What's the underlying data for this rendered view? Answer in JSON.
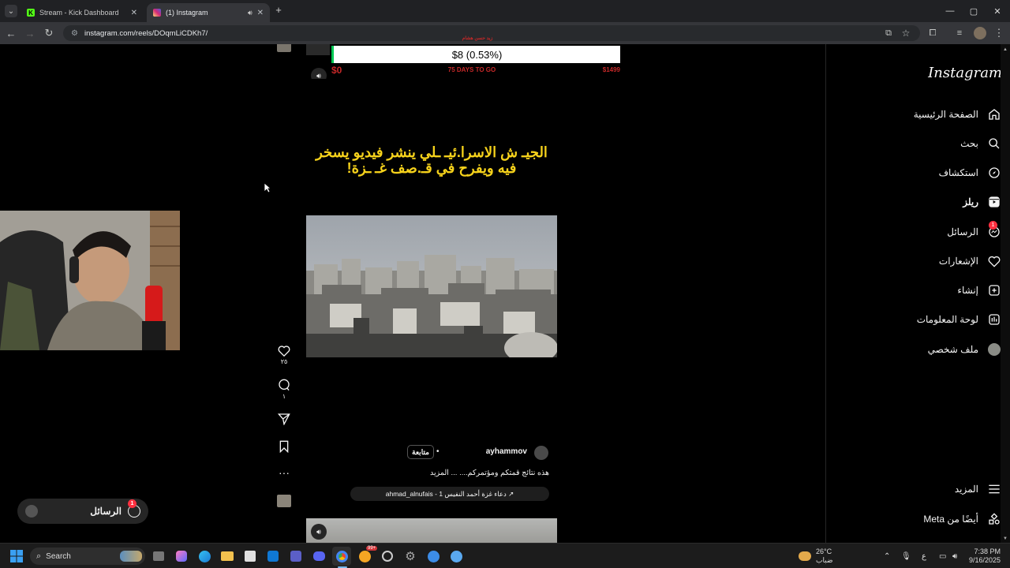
{
  "browser": {
    "tabs": [
      {
        "title": "Stream - Kick Dashboard",
        "favicon": "kick-icon",
        "color": "#53fc18"
      },
      {
        "title": "(1) Instagram",
        "favicon": "instagram-icon",
        "color": "#e1306c"
      }
    ],
    "url": "instagram.com/reels/DOqmLiCDKh7/"
  },
  "instagram": {
    "logo": "Instagram",
    "nav": [
      {
        "label": "الصفحة الرئيسية",
        "icon": "home-icon"
      },
      {
        "label": "بحث",
        "icon": "search-icon"
      },
      {
        "label": "استكشاف",
        "icon": "compass-icon"
      },
      {
        "label": "ريلز",
        "icon": "reels-icon"
      },
      {
        "label": "الرسائل",
        "icon": "messenger-icon",
        "badge": "1"
      },
      {
        "label": "الإشعارات",
        "icon": "heart-icon"
      },
      {
        "label": "إنشاء",
        "icon": "create-icon"
      },
      {
        "label": "لوحة المعلومات",
        "icon": "dashboard-icon"
      },
      {
        "label": "ملف شخصي",
        "icon": "profile-icon"
      }
    ],
    "more": "المزيد",
    "also_meta": "أيضًا من Meta"
  },
  "overlay": {
    "goal_small": "زيد حسن هشام",
    "goal_value": "$8 (0.53%)",
    "goal_min": "$0",
    "goal_days": "75 DAYS TO GO",
    "goal_max": "$1499"
  },
  "reel": {
    "caption_overlay": "الجيـ ش الاسرا.ئيـ ـلي ينشر فيديو يسخر فيه ويفرح في قـ.صف غـ ـزة!",
    "likes": "٢٥",
    "comments": "١",
    "username": "ayhammov",
    "follow": "متابعة",
    "caption": "هذه نتائج قمتكم ومؤتمركم.... ... المزيد",
    "audio": "ahmad_alnufais - دعاء غزة أحمد النفيس 1 ↗"
  },
  "messages_pill": {
    "label": "الرسائل",
    "badge": "1"
  },
  "taskbar": {
    "search": "Search",
    "weather_temp": "26°C",
    "weather_desc": "ضباب",
    "lang": "ع",
    "time": "7:38 PM",
    "date": "9/16/2025",
    "badge": "99+"
  }
}
